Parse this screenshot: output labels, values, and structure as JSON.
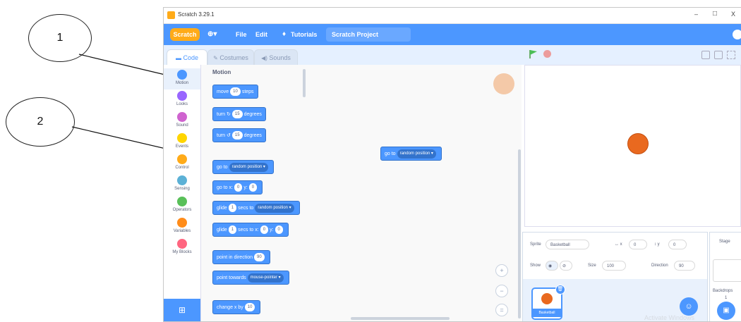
{
  "callouts": [
    "1",
    "2"
  ],
  "window": {
    "title": "Scratch 3.29.1",
    "controls": {
      "minimize": "–",
      "maximize": "□",
      "close": "X"
    }
  },
  "menubar": {
    "logo": "Scratch",
    "globe": "⊕▾",
    "file": "File",
    "edit": "Edit",
    "tutorials": "Tutorials",
    "project_title": "Scratch Project"
  },
  "tabs": [
    {
      "label": "Code",
      "icon": "code-icon"
    },
    {
      "label": "Costumes",
      "icon": "brush-icon"
    },
    {
      "label": "Sounds",
      "icon": "speaker-icon"
    }
  ],
  "categories": [
    {
      "label": "Motion",
      "color": "#4c97ff"
    },
    {
      "label": "Looks",
      "color": "#9966ff"
    },
    {
      "label": "Sound",
      "color": "#cf63cf"
    },
    {
      "label": "Events",
      "color": "#ffd500"
    },
    {
      "label": "Control",
      "color": "#ffab19"
    },
    {
      "label": "Sensing",
      "color": "#5cb1d6"
    },
    {
      "label": "Operators",
      "color": "#59c059"
    },
    {
      "label": "Variables",
      "color": "#ff8c1a"
    },
    {
      "label": "My Blocks",
      "color": "#ff6680"
    }
  ],
  "palette": {
    "heading": "Motion",
    "blocks": {
      "move": {
        "pre": "move",
        "val": "10",
        "post": "steps"
      },
      "turn_right": {
        "pre": "turn ↻",
        "val": "15",
        "post": "degrees"
      },
      "turn_left": {
        "pre": "turn ↺",
        "val": "15",
        "post": "degrees"
      },
      "goto": {
        "pre": "go to",
        "drop": "random position ▾"
      },
      "gotoxy": {
        "pre": "go to x:",
        "x": "0",
        "mid": "y:",
        "y": "0"
      },
      "glide_to": {
        "pre": "glide",
        "val": "1",
        "mid": "secs to",
        "drop": "random position ▾"
      },
      "glide_xy": {
        "pre": "glide",
        "val": "1",
        "mid": "secs to x:",
        "x": "0",
        "mid2": "y:",
        "y": "0"
      },
      "point_dir": {
        "pre": "point in direction",
        "val": "90"
      },
      "point_towards": {
        "pre": "point towards",
        "drop": "mouse-pointer ▾"
      },
      "change_x": {
        "pre": "change x by",
        "val": "10"
      }
    }
  },
  "script_area": {
    "block": {
      "pre": "go to",
      "drop": "random position ▾"
    },
    "zoom": {
      "in": "+",
      "out": "−",
      "reset": "="
    }
  },
  "stage_controls": {
    "flag": "green-flag-icon",
    "stop": "stop-icon"
  },
  "sprite_info": {
    "sprite_label": "Sprite",
    "sprite_name": "Basketball",
    "x_label": "↔ x",
    "x_value": "0",
    "y_label": "↕ y",
    "y_value": "0",
    "show_label": "Show",
    "size_label": "Size",
    "size_value": "100",
    "direction_label": "Direction",
    "direction_value": "90"
  },
  "sprite_list": [
    {
      "name": "Basketball"
    }
  ],
  "stage_panel": {
    "title": "Stage",
    "backdrops_label": "Backdrops",
    "backdrops_count": "1"
  },
  "watermark": "Activate Windows"
}
